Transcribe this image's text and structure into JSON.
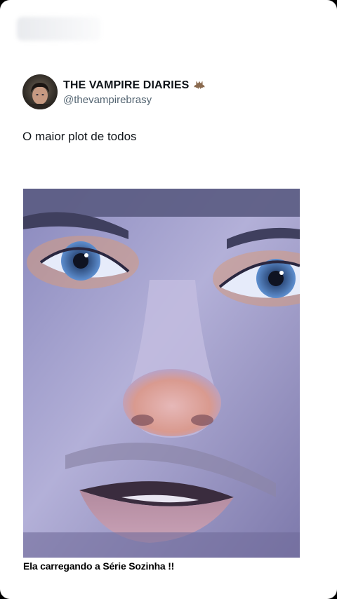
{
  "tweet": {
    "display_name": "THE VAMPIRE DIARIES",
    "handle": "@thevampirebrasy",
    "text": "O maior plot de todos",
    "badge_icon": "bat-icon"
  },
  "media": {
    "caption": "Ela carregando a Série Sozinha !!"
  }
}
